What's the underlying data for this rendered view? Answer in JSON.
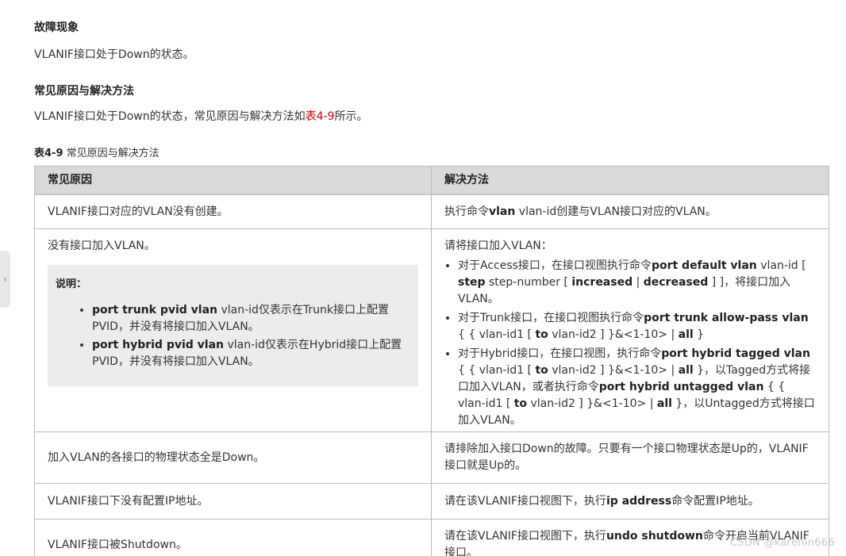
{
  "sections": {
    "fault_title": "故障现象",
    "fault_text": "VLANIF接口处于Down的状态。",
    "cause_title": "常见原因与解决方法",
    "cause_text_prefix": "VLANIF接口处于Down的状态，常见原因与解决方法如",
    "cause_text_link": "表4-9",
    "cause_text_suffix": "所示。"
  },
  "caption": {
    "label": "表4-9",
    "title": " 常见原因与解决方法"
  },
  "table": {
    "headers": [
      "常见原因",
      "解决方法"
    ],
    "rows": [
      {
        "cause": "VLANIF接口对应的VLAN没有创建。",
        "solution_pre": "执行命令",
        "solution_cmd": "vlan",
        "solution_post": " vlan-id创建与VLAN接口对应的VLAN。"
      },
      {
        "cause": "没有接口加入VLAN。",
        "note_title": "说明：",
        "note_items": [
          {
            "cmd": "port trunk pvid vlan",
            "text": " vlan-id仅表示在Trunk接口上配置PVID，并没有将接口加入VLAN。"
          },
          {
            "cmd": "port hybrid pvid vlan",
            "text": " vlan-id仅表示在Hybrid接口上配置PVID，并没有将接口加入VLAN。"
          }
        ],
        "solution_intro": "请将接口加入VLAN：",
        "solution_items": [
          {
            "a": "对于Access接口，在接口视图执行命令",
            "b": "port default vlan",
            "c": " vlan-id [ ",
            "d": "step",
            "e": " step-number [ ",
            "f": "increased",
            "g": " | ",
            "h": "decreased",
            "i": " ] ]，将接口加入VLAN。"
          },
          {
            "a": "对于Trunk接口，在接口视图执行命令",
            "b": "port trunk allow-pass vlan",
            "c": " { { vlan-id1 [ ",
            "d": "to",
            "e": " vlan-id2 ] }&<1-10> | ",
            "f": "all",
            "g": " }"
          },
          {
            "a": "对于Hybrid接口，在接口视图，执行命令",
            "b": "port hybrid tagged vlan",
            "c": " { { vlan-id1 [ ",
            "d": "to",
            "e": " vlan-id2 ] }&<1-10> | ",
            "f": "all",
            "g": " }，以Tagged方式将接口加入VLAN，或者执行命令",
            "h": "port hybrid untagged vlan",
            "i": " { { vlan-id1 [ ",
            "j": "to",
            "k": " vlan-id2 ] }&<1-10> | ",
            "l": "all",
            "m": " }，以Untagged方式将接口加入VLAN。"
          }
        ]
      },
      {
        "cause": "加入VLAN的各接口的物理状态全是Down。",
        "solution": "请排除加入接口Down的故障。只要有一个接口物理状态是Up的，VLANIF接口就是Up的。"
      },
      {
        "cause": "VLANIF接口下没有配置IP地址。",
        "solution_pre": "请在该VLANIF接口视图下，执行",
        "solution_cmd": "ip address",
        "solution_post": "命令配置IP地址。"
      },
      {
        "cause": "VLANIF接口被Shutdown。",
        "solution_pre": "请在该VLANIF接口视图下，执行",
        "solution_cmd": "undo shutdown",
        "solution_post": "命令开启当前VLANIF接口。"
      }
    ]
  },
  "side_handle_glyph": "‹",
  "watermark": "CSDN @karenin666"
}
